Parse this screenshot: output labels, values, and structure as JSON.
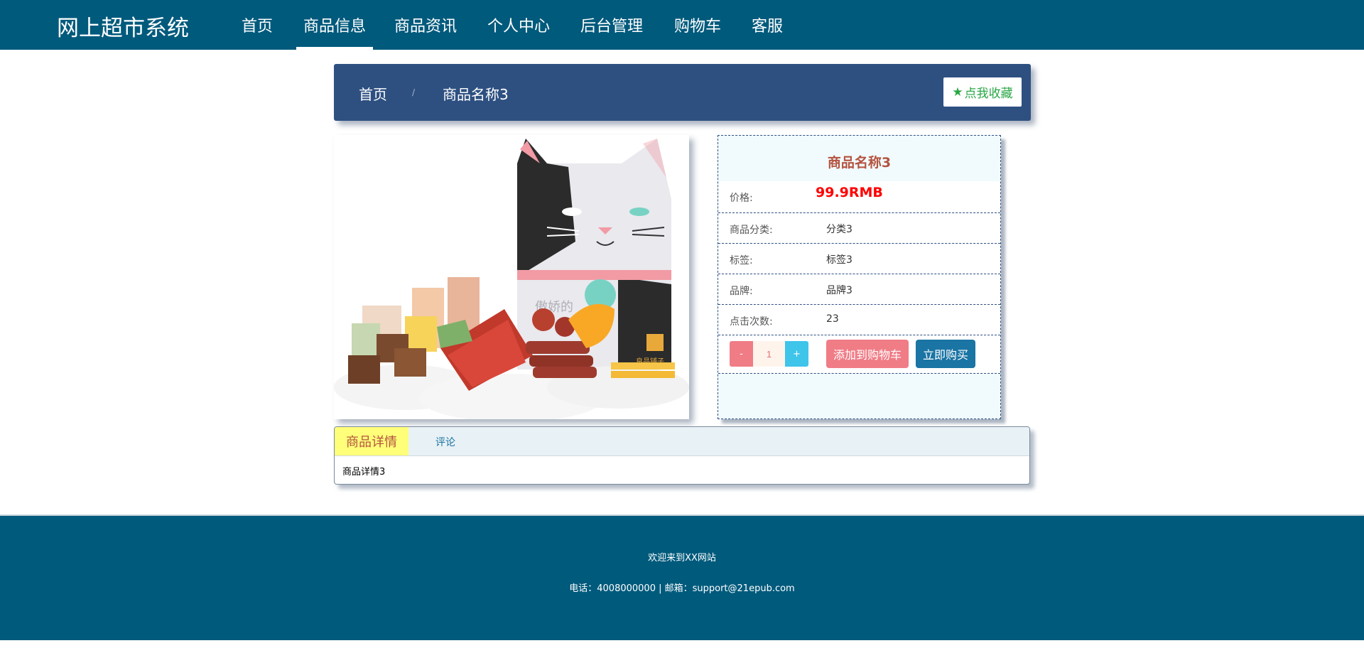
{
  "brand": "网上超市系统",
  "nav": [
    {
      "label": "首页"
    },
    {
      "label": "商品信息"
    },
    {
      "label": "商品资讯"
    },
    {
      "label": "个人中心"
    },
    {
      "label": "后台管理"
    },
    {
      "label": "购物车"
    },
    {
      "label": "客服"
    }
  ],
  "nav_active": "商品信息",
  "breadcrumb": {
    "home": "首页",
    "separator": "/",
    "current": "商品名称3"
  },
  "favorite_label": "点我收藏",
  "product": {
    "name": "商品名称3",
    "price_label": "价格:",
    "price": "99.9RMB",
    "rows": [
      {
        "label": "商品分类:",
        "value": "分类3"
      },
      {
        "label": "标签:",
        "value": "标签3"
      },
      {
        "label": "品牌:",
        "value": "品牌3"
      },
      {
        "label": "点击次数:",
        "value": "23"
      }
    ],
    "image_text": {
      "package_text": "傲娇的",
      "brand_text": "良品铺子"
    }
  },
  "quantity": {
    "minus": "-",
    "value": "1",
    "plus": "+"
  },
  "buttons": {
    "add_cart": "添加到购物车",
    "buy_now": "立即购买"
  },
  "tabs": [
    {
      "label": "商品详情"
    },
    {
      "label": "评论"
    }
  ],
  "detail_text": "商品详情3",
  "footer": {
    "welcome": "欢迎来到XX网站",
    "contact": "电话：4008000000 | 邮箱：support@21epub.com"
  },
  "colors": {
    "nav_bg": "#005a7c",
    "breadcrumb_bg": "#2e5081",
    "price": "#ff0000",
    "title": "#b4533f",
    "add_cart": "#f07c86",
    "buy_now": "#1a74a4",
    "active_tab": "#ffff7a"
  }
}
